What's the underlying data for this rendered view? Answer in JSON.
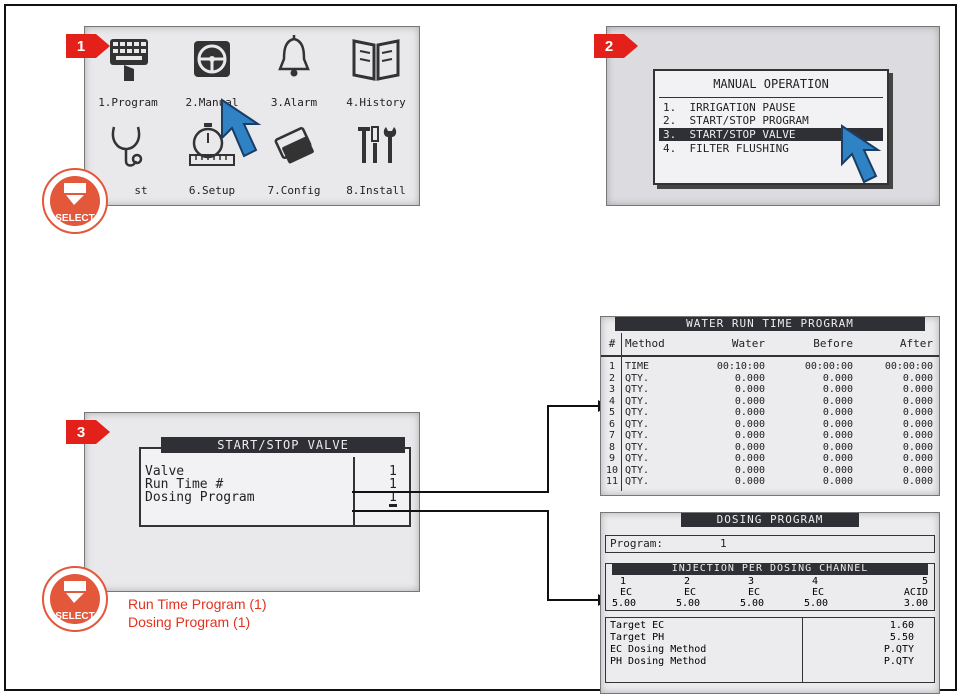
{
  "steps": [
    "1",
    "2",
    "3"
  ],
  "main_menu": {
    "items": [
      {
        "label": "1.Program"
      },
      {
        "label": "2.Manual"
      },
      {
        "label": "3.Alarm"
      },
      {
        "label": "4.History"
      },
      {
        "label": "st"
      },
      {
        "label": "6.Setup"
      },
      {
        "label": "7.Config"
      },
      {
        "label": "8.Install"
      }
    ]
  },
  "select_badge": {
    "label": "SELECT"
  },
  "manual_operation": {
    "title": "MANUAL OPERATION",
    "options": [
      {
        "label": "1.  IRRIGATION PAUSE"
      },
      {
        "label": "2.  START/STOP PROGRAM"
      },
      {
        "label": "3.  START/STOP VALVE",
        "selected": true
      },
      {
        "label": "4.  FILTER FLUSHING"
      }
    ]
  },
  "start_stop_valve": {
    "title": "START/STOP VALVE",
    "fields": [
      {
        "label": "Valve",
        "value": "1"
      },
      {
        "label": "Run Time #",
        "value": "1"
      },
      {
        "label": "Dosing Program",
        "value": "1"
      }
    ]
  },
  "legend": {
    "line1": "Run Time Program (1)",
    "line2": "Dosing Program (1)"
  },
  "water_run_time": {
    "title": "WATER RUN TIME PROGRAM",
    "headers": [
      "#",
      "Method",
      "Water",
      "Before",
      "After"
    ],
    "rows": [
      [
        "1",
        "TIME",
        "00:10:00",
        "00:00:00",
        "00:00:00"
      ],
      [
        "2",
        "QTY.",
        "0.000",
        "0.000",
        "0.000"
      ],
      [
        "3",
        "QTY.",
        "0.000",
        "0.000",
        "0.000"
      ],
      [
        "4",
        "QTY.",
        "0.000",
        "0.000",
        "0.000"
      ],
      [
        "5",
        "QTY.",
        "0.000",
        "0.000",
        "0.000"
      ],
      [
        "6",
        "QTY.",
        "0.000",
        "0.000",
        "0.000"
      ],
      [
        "7",
        "QTY.",
        "0.000",
        "0.000",
        "0.000"
      ],
      [
        "8",
        "QTY.",
        "0.000",
        "0.000",
        "0.000"
      ],
      [
        "9",
        "QTY.",
        "0.000",
        "0.000",
        "0.000"
      ],
      [
        "10",
        "QTY.",
        "0.000",
        "0.000",
        "0.000"
      ],
      [
        "11",
        "QTY.",
        "0.000",
        "0.000",
        "0.000"
      ]
    ]
  },
  "dosing_program": {
    "title": "DOSING PROGRAM",
    "program_label": "Program:",
    "program_value": "1",
    "injection_title": "INJECTION PER DOSING CHANNEL",
    "channels": [
      {
        "num": "1",
        "type": "EC",
        "value": "5.00"
      },
      {
        "num": "2",
        "type": "EC",
        "value": "5.00"
      },
      {
        "num": "3",
        "type": "EC",
        "value": "5.00"
      },
      {
        "num": "4",
        "type": "EC",
        "value": "5.00"
      },
      {
        "num": "5",
        "type": "ACID",
        "value": "3.00"
      }
    ],
    "params": [
      {
        "label": "Target EC",
        "value": "1.60"
      },
      {
        "label": "Target PH",
        "value": "5.50"
      },
      {
        "label": "EC Dosing Method",
        "value": "P.QTY"
      },
      {
        "label": "PH Dosing Method",
        "value": "P.QTY"
      }
    ]
  },
  "colors": {
    "accent_red": "#e32019",
    "select_orange": "#e3573a",
    "lcd_bg": "#e9e9ec",
    "dark_bar": "#2f2f36"
  }
}
